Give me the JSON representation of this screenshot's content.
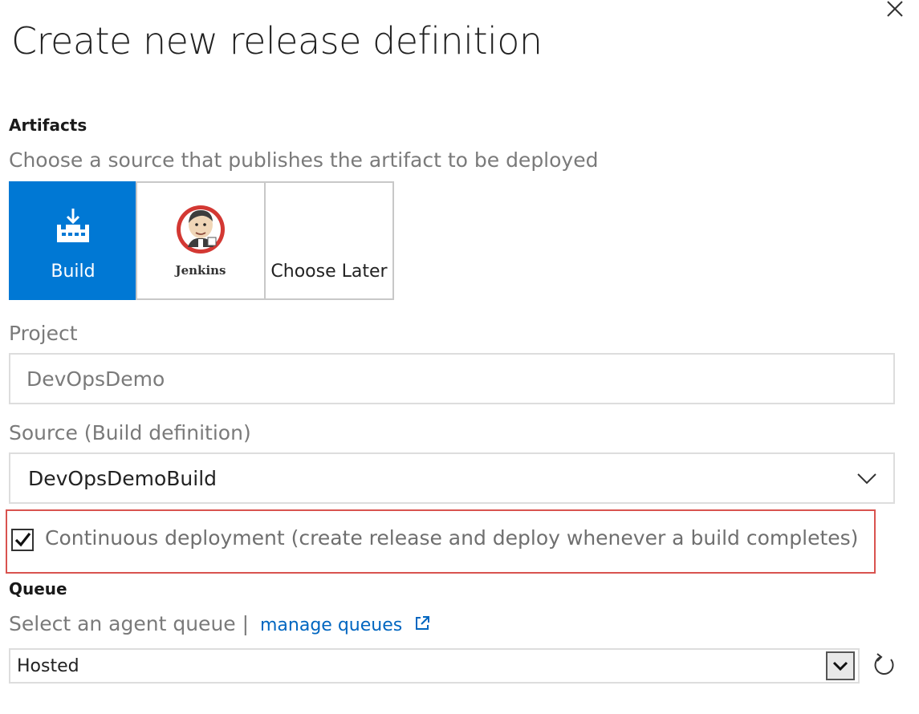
{
  "dialog": {
    "title": "Create new release definition"
  },
  "artifacts": {
    "heading": "Artifacts",
    "helper": "Choose a source that publishes the artifact to be deployed",
    "tiles": [
      {
        "label": "Build",
        "icon": "build-icon",
        "selected": true
      },
      {
        "label": "Jenkins",
        "icon": "jenkins-logo",
        "selected": false
      },
      {
        "label": "Choose Later",
        "icon": "",
        "selected": false
      }
    ]
  },
  "project": {
    "label": "Project",
    "value": "DevOpsDemo"
  },
  "source": {
    "label": "Source (Build definition)",
    "value": "DevOpsDemoBuild"
  },
  "continuous_deployment": {
    "checked": true,
    "label": "Continuous deployment (create release and deploy whenever a build completes)"
  },
  "queue": {
    "heading": "Queue",
    "helper": "Select an agent queue |",
    "manage_link": "manage queues",
    "value": "Hosted"
  },
  "colors": {
    "accent": "#0078d4",
    "link": "#0066c0",
    "highlight": "#d9534f"
  }
}
